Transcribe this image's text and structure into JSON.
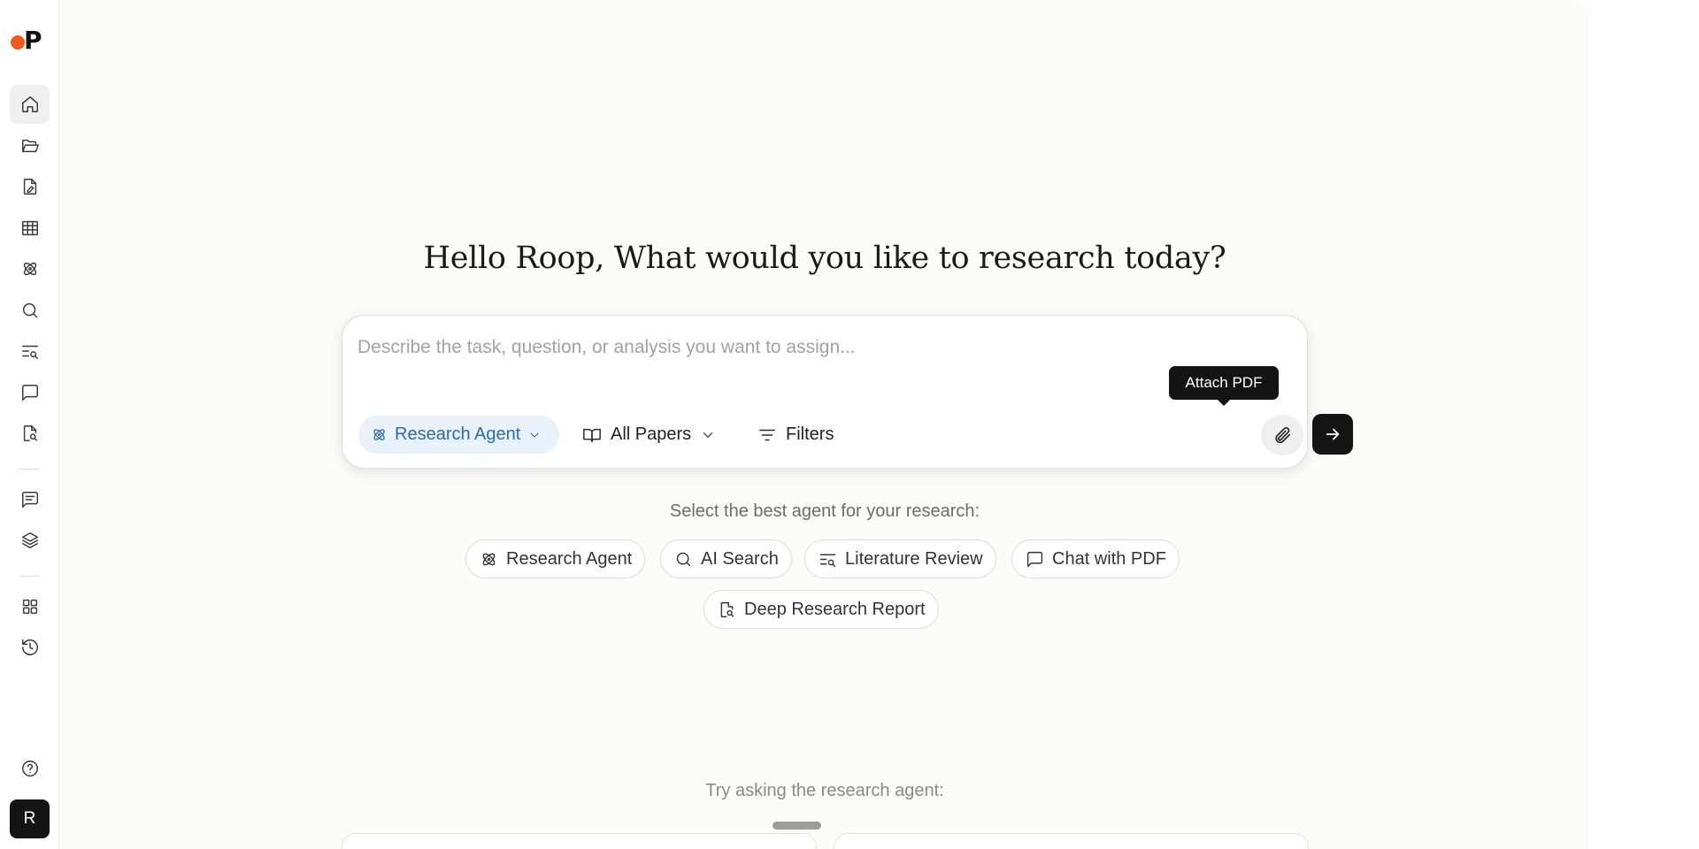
{
  "app": {
    "logo_letter": "P",
    "brand_color": "#f25a1d",
    "avatar_initial": "R"
  },
  "sidebar": {
    "items": [
      {
        "name": "home-icon",
        "active": true
      },
      {
        "name": "folder-open-icon"
      },
      {
        "name": "file-edit-icon"
      },
      {
        "name": "table-icon"
      },
      {
        "name": "atom-icon"
      },
      {
        "name": "search-icon"
      },
      {
        "name": "list-search-icon"
      },
      {
        "name": "message-square-icon"
      },
      {
        "name": "file-search-icon"
      },
      {
        "name": "message-text-icon"
      },
      {
        "name": "layers-icon"
      },
      {
        "name": "grid-icon"
      },
      {
        "name": "history-icon"
      },
      {
        "name": "help-circle-icon"
      }
    ]
  },
  "main": {
    "greeting": "Hello Roop, What would you like to research today?",
    "composer": {
      "placeholder": "Describe the task, question, or analysis you want to assign...",
      "value": "",
      "agent_label": "Research Agent",
      "papers_label": "All Papers",
      "filters_label": "Filters",
      "attach_tooltip": "Attach PDF"
    },
    "select_label": "Select the best agent for your research:",
    "agents": [
      {
        "label": "Research Agent",
        "icon": "atom-icon"
      },
      {
        "label": "AI Search",
        "icon": "search-icon"
      },
      {
        "label": "Literature Review",
        "icon": "list-search-icon"
      },
      {
        "label": "Chat with PDF",
        "icon": "message-square-icon"
      },
      {
        "label": "Deep Research Report",
        "icon": "file-search-icon"
      }
    ],
    "try_label": "Try asking the research agent:"
  }
}
